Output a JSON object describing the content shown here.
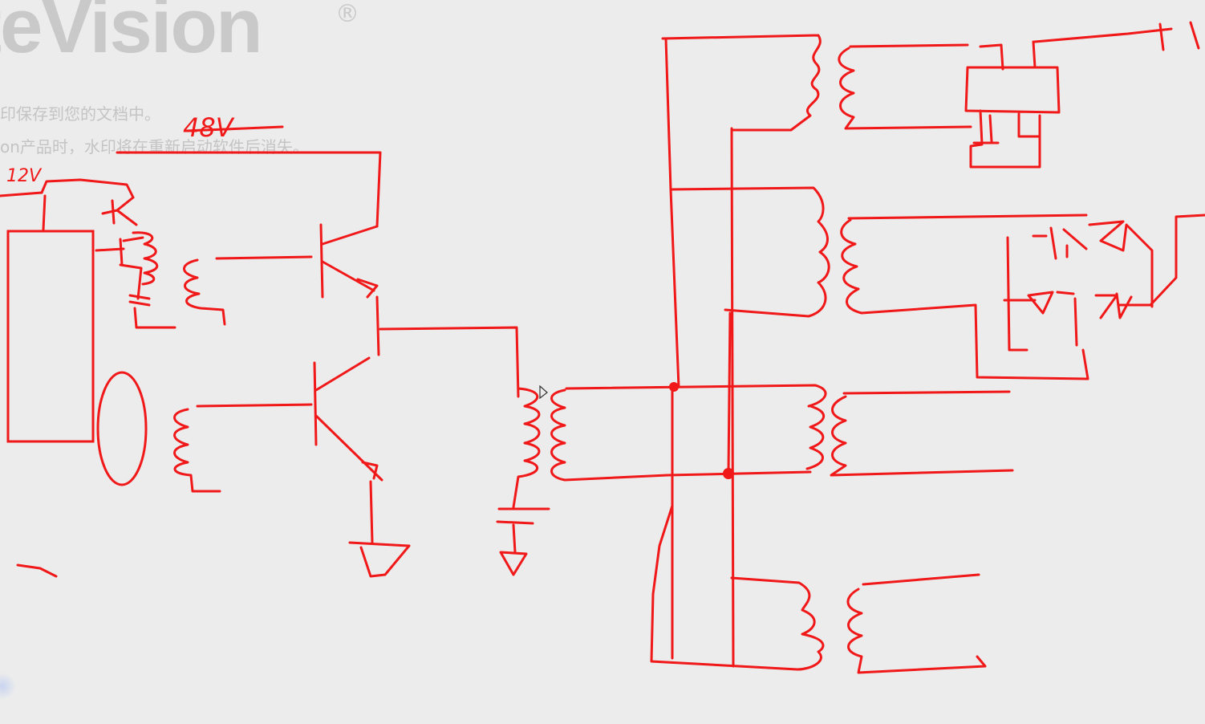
{
  "watermark": {
    "logo_text": "teVision",
    "registered_mark": "®",
    "line1": "印保存到您的文档中。",
    "line2": "on产品时，水印将在重新启动软件后消失。"
  },
  "annotations": {
    "top_voltage": "48V",
    "left_voltage": "12V"
  },
  "colors": {
    "ink": "#f01818",
    "background": "#ececec",
    "watermark": "#c9c9c9"
  }
}
